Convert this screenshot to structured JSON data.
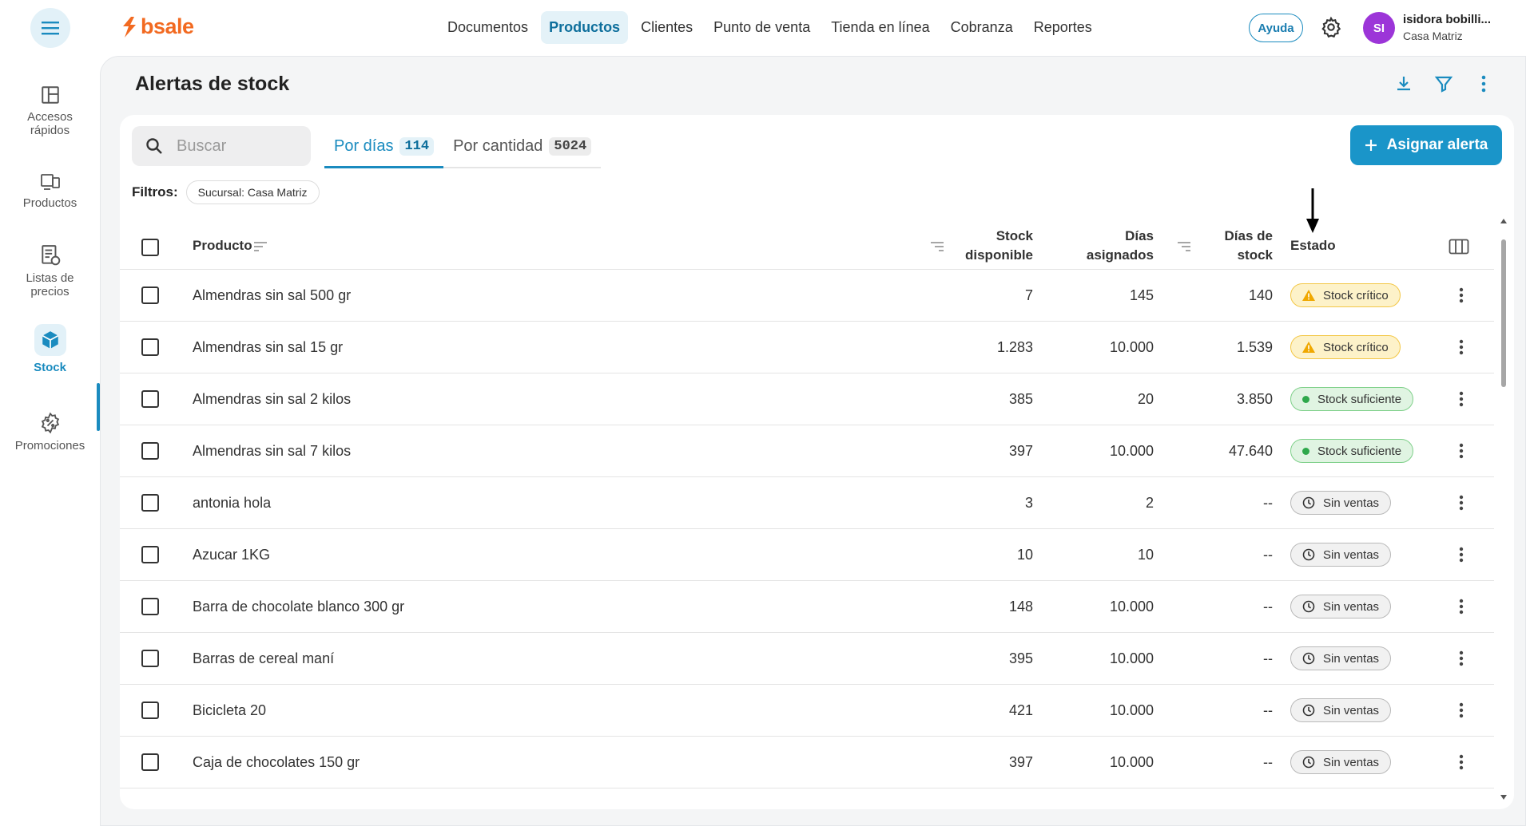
{
  "app": {
    "logo_text": "bsale",
    "nav": [
      "Documentos",
      "Productos",
      "Clientes",
      "Punto de venta",
      "Tienda en línea",
      "Cobranza",
      "Reportes"
    ],
    "active_nav": "Productos",
    "help_label": "Ayuda",
    "user": {
      "initials": "SI",
      "name": "isidora bobilli...",
      "branch": "Casa Matriz"
    }
  },
  "sidebar": {
    "items": [
      {
        "label": "Accesos rápidos",
        "icon": "layout-icon"
      },
      {
        "label": "Productos",
        "icon": "products-icon"
      },
      {
        "label": "Listas de precios",
        "icon": "price-list-icon"
      },
      {
        "label": "Stock",
        "icon": "cube-icon",
        "active": true
      },
      {
        "label": "Promociones",
        "icon": "promo-icon"
      }
    ]
  },
  "page": {
    "title": "Alertas de stock",
    "search_placeholder": "Buscar",
    "tabs": [
      {
        "label": "Por días",
        "count": "114",
        "active": true
      },
      {
        "label": "Por cantidad",
        "count": "5024",
        "active": false
      }
    ],
    "assign_button": "Asignar alerta",
    "filters_label": "Filtros:",
    "filter_chip": "Sucursal: Casa Matriz"
  },
  "table": {
    "headers": {
      "product": "Producto",
      "stock": [
        "Stock",
        "disponible"
      ],
      "assigned": [
        "Días",
        "asignados"
      ],
      "days": [
        "Días de",
        "stock"
      ],
      "status": "Estado"
    },
    "rows": [
      {
        "product": "Almendras sin sal 500 gr",
        "stock": "7",
        "assigned": "145",
        "days": "140",
        "status": "Stock crítico",
        "kind": "critical"
      },
      {
        "product": "Almendras sin sal 15 gr",
        "stock": "1.283",
        "assigned": "10.000",
        "days": "1.539",
        "status": "Stock crítico",
        "kind": "critical"
      },
      {
        "product": "Almendras sin sal 2 kilos",
        "stock": "385",
        "assigned": "20",
        "days": "3.850",
        "status": "Stock suficiente",
        "kind": "ok"
      },
      {
        "product": "Almendras sin sal 7 kilos",
        "stock": "397",
        "assigned": "10.000",
        "days": "47.640",
        "status": "Stock suficiente",
        "kind": "ok"
      },
      {
        "product": "antonia hola",
        "stock": "3",
        "assigned": "2",
        "days": "--",
        "status": "Sin ventas",
        "kind": "none"
      },
      {
        "product": "Azucar 1KG",
        "stock": "10",
        "assigned": "10",
        "days": "--",
        "status": "Sin ventas",
        "kind": "none"
      },
      {
        "product": "Barra de chocolate blanco 300 gr",
        "stock": "148",
        "assigned": "10.000",
        "days": "--",
        "status": "Sin ventas",
        "kind": "none"
      },
      {
        "product": "Barras de cereal maní",
        "stock": "395",
        "assigned": "10.000",
        "days": "--",
        "status": "Sin ventas",
        "kind": "none"
      },
      {
        "product": "Bicicleta 20",
        "stock": "421",
        "assigned": "10.000",
        "days": "--",
        "status": "Sin ventas",
        "kind": "none"
      },
      {
        "product": "Caja de chocolates 150 gr",
        "stock": "397",
        "assigned": "10.000",
        "days": "--",
        "status": "Sin ventas",
        "kind": "none"
      }
    ]
  },
  "colors": {
    "primary": "#1a95c9",
    "brand": "#f26a21",
    "critical": "#f3c746",
    "ok": "#2ea84b"
  }
}
